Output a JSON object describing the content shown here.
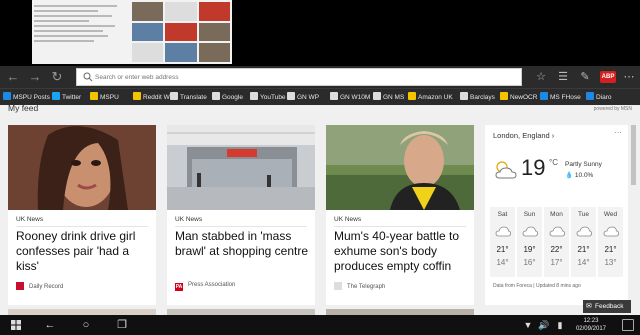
{
  "browser": {
    "address_placeholder": "Search or enter web address",
    "abp_label": "ABP"
  },
  "favorites": [
    {
      "label": "MSPU Posts",
      "color": "#1e88e5"
    },
    {
      "label": "Twitter",
      "color": "#1da1f2"
    },
    {
      "label": "MSPU",
      "color": "#f5c400"
    },
    {
      "label": "Reddit WP",
      "color": "#f5c400"
    },
    {
      "label": "Translate",
      "color": "#dddddd"
    },
    {
      "label": "Google",
      "color": "#dddddd"
    },
    {
      "label": "YouTube",
      "color": "#dddddd"
    },
    {
      "label": "GN WP",
      "color": "#dddddd"
    },
    {
      "label": "GN W10M",
      "color": "#dddddd"
    },
    {
      "label": "GN MS",
      "color": "#dddddd"
    },
    {
      "label": "Amazon UK",
      "color": "#f5c400"
    },
    {
      "label": "Barclays",
      "color": "#dddddd"
    },
    {
      "label": "NewOCR",
      "color": "#f5c400"
    },
    {
      "label": "MS FHose",
      "color": "#1e88e5"
    },
    {
      "label": "Diaro",
      "color": "#1e88e5"
    }
  ],
  "feed": {
    "title": "My feed",
    "powered_by": "powered by MSN"
  },
  "cards": [
    {
      "category": "UK News",
      "headline": "Rooney drink drive girl confesses pair 'had a kiss'",
      "source": "Daily Record",
      "logo_color": "#c8102e",
      "logo_text": ""
    },
    {
      "category": "UK News",
      "headline": "Man stabbed in 'mass brawl' at shopping centre",
      "source": "Press Association",
      "logo_color": "#d6001c",
      "logo_text": "PA"
    },
    {
      "category": "UK News",
      "headline": "Mum's 40-year battle to exhume son's body produces empty coffin",
      "source": "The Telegraph",
      "logo_color": "#dddddd",
      "logo_text": ""
    }
  ],
  "weather": {
    "location": "London, England",
    "temperature": "19",
    "unit": "°C",
    "condition": "Partly Sunny",
    "precip": "10.0%",
    "forecast": [
      {
        "day": "Sat",
        "hi": "21°",
        "lo": "14°"
      },
      {
        "day": "Sun",
        "hi": "19°",
        "lo": "16°"
      },
      {
        "day": "Mon",
        "hi": "22°",
        "lo": "17°"
      },
      {
        "day": "Tue",
        "hi": "21°",
        "lo": "14°"
      },
      {
        "day": "Wed",
        "hi": "21°",
        "lo": "13°"
      }
    ],
    "footer": "Data from Foreca | Updated 8 mins ago"
  },
  "feedback_label": "Feedback",
  "taskbar": {
    "time": "12:23",
    "date": "02/09/2017"
  }
}
